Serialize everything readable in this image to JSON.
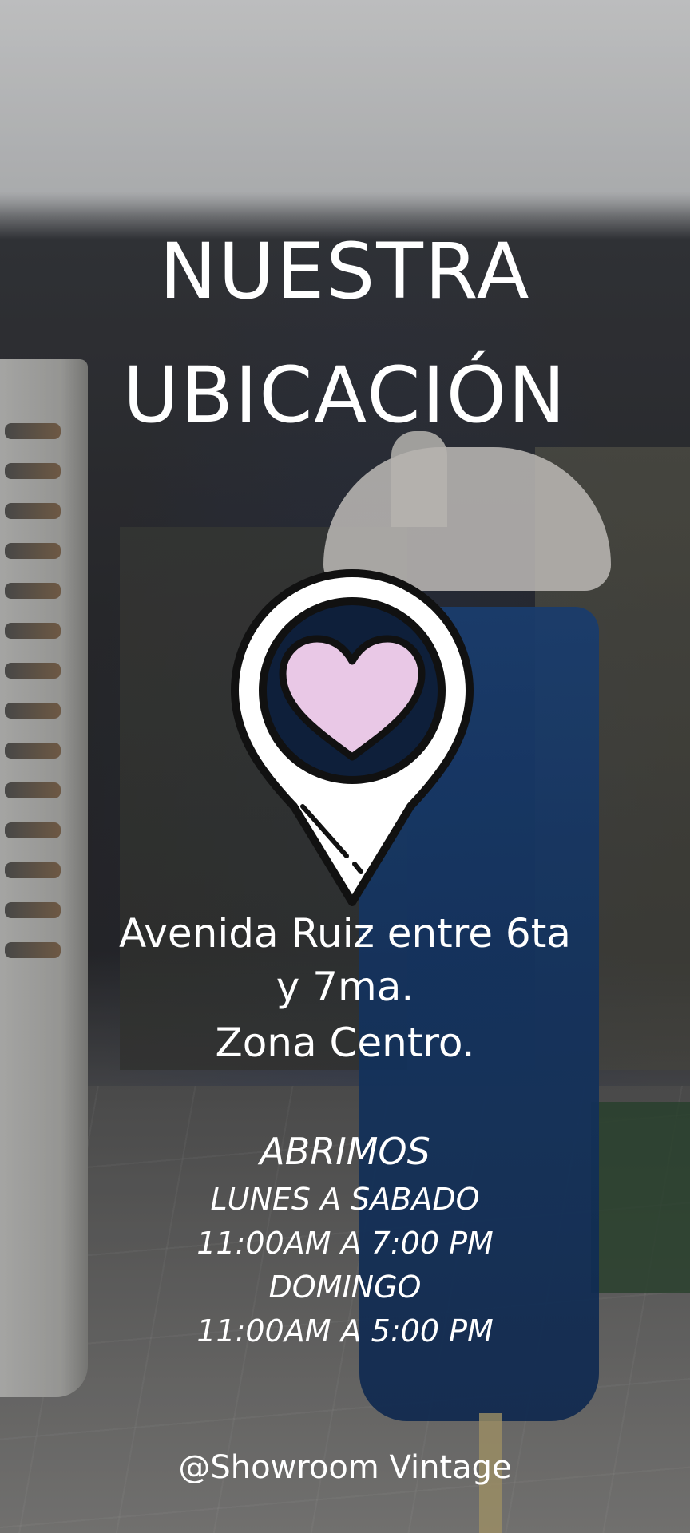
{
  "title": {
    "line1": "NUESTRA",
    "line2": "UBICACIÓN"
  },
  "pin_icon": {
    "name": "location-pin-heart-icon",
    "heart_color": "#e9c8e6",
    "pin_color": "#ffffff",
    "outline_color": "#111111"
  },
  "address": {
    "line1": "Avenida Ruiz entre 6ta",
    "line2": "y 7ma.",
    "line3": "Zona Centro."
  },
  "hours": {
    "heading": "ABRIMOS",
    "weekdays_label": "LUNES A SABADO",
    "weekdays_hours": "11:00AM A 7:00 PM",
    "sunday_label": "DOMINGO",
    "sunday_hours": "11:00AM A 5:00 PM"
  },
  "footer": {
    "handle": "@Showroom Vintage"
  }
}
